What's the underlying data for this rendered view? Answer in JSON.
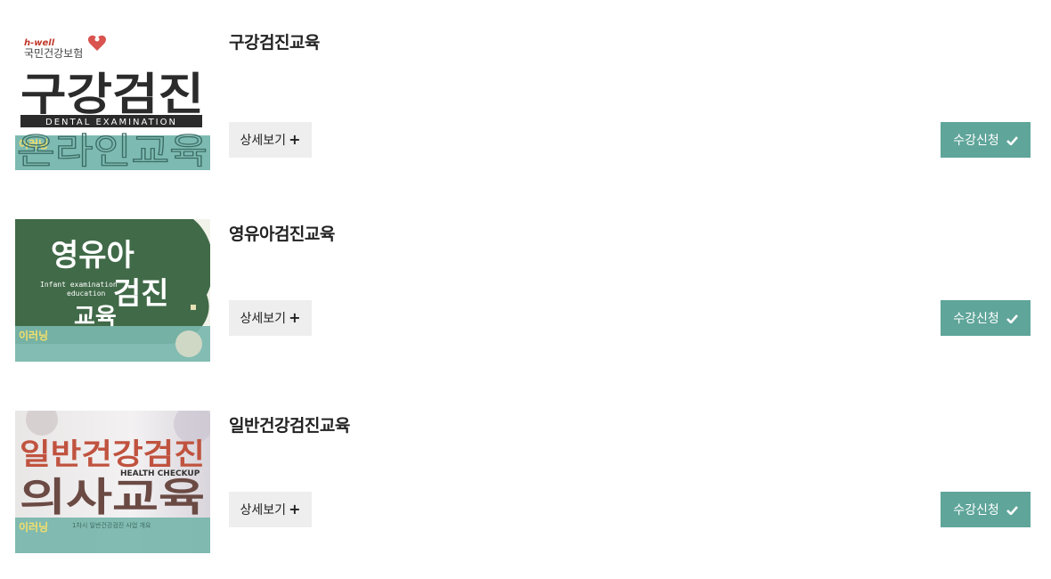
{
  "courses": [
    {
      "title": "구강검진교육",
      "detail_label": "상세보기",
      "apply_label": "수강신청",
      "thumb": {
        "badge": "이러닝",
        "brand_small": "h-well",
        "brand": "국민건강보험",
        "headline": "구강검진",
        "subtitle": "DENTAL EXAMINATION",
        "bottom": "온라인교육"
      }
    },
    {
      "title": "영유아검진교육",
      "detail_label": "상세보기",
      "apply_label": "수강신청",
      "thumb": {
        "badge": "이러닝",
        "line1": "영유아",
        "line2": "검진",
        "line3": "교육",
        "sub1": "Infant examination",
        "sub2": "education"
      }
    },
    {
      "title": "일반건강검진교육",
      "detail_label": "상세보기",
      "apply_label": "수강신청",
      "thumb": {
        "badge": "이러닝",
        "line1": "일반건강검진",
        "sub": "HEALTH CHECKUP",
        "line2": "의사교육",
        "caption": "1차시 일반건강검진 사업 개요"
      }
    }
  ],
  "colors": {
    "accent": "#5fa59a",
    "detail_bg": "#eeeeee",
    "badge_text": "#f3df6a"
  },
  "icons": {
    "detail": "plus-icon",
    "apply": "check-icon"
  }
}
